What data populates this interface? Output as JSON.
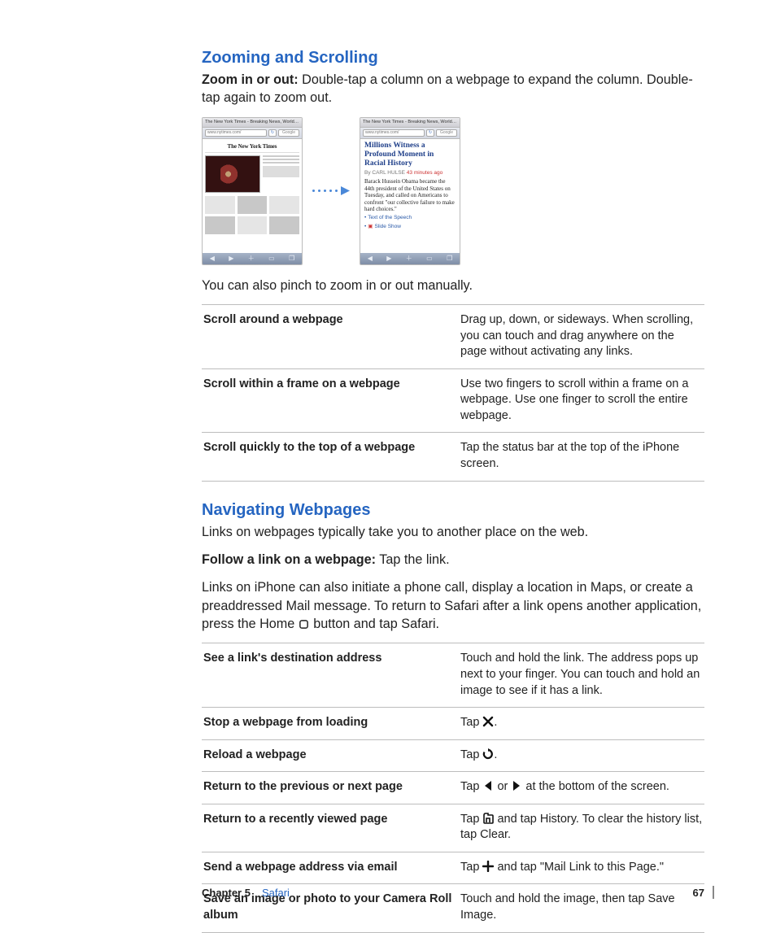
{
  "sections": {
    "zoom": {
      "heading": "Zooming and Scrolling",
      "lead_bold": "Zoom in or out:",
      "lead_rest": "  Double-tap a column on a webpage to expand the column. Double-tap again to zoom out.",
      "after_figure": "You can also pinch to zoom in or out manually."
    },
    "nav": {
      "heading": "Navigating Webpages",
      "intro": "Links on webpages typically take you to another place on the web.",
      "follow_bold": "Follow a link on a webpage:",
      "follow_rest": "  Tap the link.",
      "para2_pre": "Links on iPhone can also initiate a phone call, display a location in Maps, or create a preaddressed Mail message. To return to Safari after a link opens another application, press the Home ",
      "para2_post": " button and tap Safari."
    }
  },
  "phone_left": {
    "title": "The New York Times - Breaking News, World…",
    "url": "www.nytimes.com/",
    "refresh": "↻",
    "search": "Google",
    "masthead": "The New York Times"
  },
  "phone_right": {
    "title": "The New York Times - Breaking News, World…",
    "url": "www.nytimes.com/",
    "refresh": "↻",
    "search": "Google",
    "headline": "Millions Witness a Profound Moment in Racial History",
    "byline_prefix": "By CARL HULSE ",
    "byline_time": "43 minutes ago",
    "para": "Barack Hussein Obama became the 44th president of the United States on Tuesday, and called on Americans to confront \"our collective failure to make hard choices.\"",
    "link1": "Text of the Speech",
    "link2": "Slide Show"
  },
  "toolbar_icons": {
    "prev": "◀",
    "next": "▶",
    "add": "＋",
    "bookmarks": "▭",
    "pages": "❐"
  },
  "table_scroll": [
    {
      "left": "Scroll around a webpage",
      "right": "Drag up, down, or sideways. When scrolling, you can touch and drag anywhere on the page without activating any links."
    },
    {
      "left": "Scroll within a frame on a webpage",
      "right": "Use two fingers to scroll within a frame on a webpage. Use one finger to scroll the entire webpage."
    },
    {
      "left": "Scroll quickly to the top of a webpage",
      "right": "Tap the status bar at the top of the iPhone screen."
    }
  ],
  "table_nav": [
    {
      "left": "See a link's destination address",
      "right_pre": "Touch and hold the link. The address pops up next to your finger. You can touch and hold an image to see if it has a link.",
      "icons": []
    },
    {
      "left": "Stop a webpage from loading",
      "right_pre": "Tap ",
      "icons": [
        "x"
      ],
      "right_post": "."
    },
    {
      "left": "Reload a webpage",
      "right_pre": "Tap ",
      "icons": [
        "reload"
      ],
      "right_post": "."
    },
    {
      "left": "Return to the previous or next page",
      "right_pre": "Tap ",
      "icons": [
        "back"
      ],
      "right_mid": " or ",
      "icons2": [
        "forward"
      ],
      "right_post": " at the bottom of the screen."
    },
    {
      "left": "Return to a recently viewed page",
      "right_pre": "Tap ",
      "icons": [
        "bookmarks"
      ],
      "right_post": " and tap History. To clear the history list, tap Clear."
    },
    {
      "left": "Send a webpage address via email",
      "right_pre": "Tap ",
      "icons": [
        "plus"
      ],
      "right_post": " and tap \"Mail Link to this Page.\""
    },
    {
      "left": "Save an image or photo to your Camera Roll album",
      "right_pre": "Touch and hold the image, then tap Save Image.",
      "icons": []
    }
  ],
  "footer": {
    "chapter_label": "Chapter 5",
    "chapter_name": "Safari",
    "page_number": "67"
  }
}
